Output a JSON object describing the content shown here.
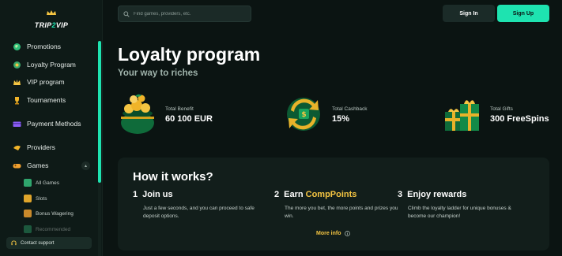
{
  "brand": {
    "logo_text_a": "TRIP",
    "logo_text_b": "2",
    "logo_text_c": "VIP"
  },
  "header": {
    "search_placeholder": "Find games, providers, etc.",
    "signin_label": "Sign In",
    "signup_label": "Sign Up"
  },
  "sidebar": {
    "items": [
      {
        "label": "Promotions",
        "icon": "globe-icon"
      },
      {
        "label": "Loyalty Program",
        "icon": "loyalty-icon"
      },
      {
        "label": "VIP program",
        "icon": "crown-icon"
      },
      {
        "label": "Tournaments",
        "icon": "trophy-icon"
      },
      {
        "label": "Payment Methods",
        "icon": "card-icon"
      },
      {
        "label": "Providers",
        "icon": "providers-icon"
      },
      {
        "label": "Games",
        "icon": "gamepad-icon"
      }
    ],
    "sub_items": [
      {
        "label": "All Games",
        "icon": "grid-icon"
      },
      {
        "label": "Slots",
        "icon": "slots-icon"
      },
      {
        "label": "Bonus Wagering",
        "icon": "bonus-icon"
      },
      {
        "label": "Recommended",
        "icon": "recommended-icon"
      }
    ],
    "support_label": "Contact support"
  },
  "main": {
    "title": "Loyalty program",
    "subtitle": "Your way to riches",
    "stats": [
      {
        "label": "Total Benefit",
        "value": "60 100 EUR",
        "icon": "coin-pot-icon"
      },
      {
        "label": "Total Cashback",
        "value": "15%",
        "icon": "cashback-icon"
      },
      {
        "label": "Total Gifts",
        "value": "300 FreeSpins",
        "icon": "gifts-icon"
      }
    ],
    "how": {
      "title": "How it works?",
      "steps": [
        {
          "num": "1",
          "title": "Join us",
          "accent": "",
          "desc": "Just a few seconds, and you can proceed to safe deposit options."
        },
        {
          "num": "2",
          "title": "Earn ",
          "accent": "CompPoints",
          "desc": "The more you bet, the more points and prizes you win."
        },
        {
          "num": "3",
          "title": "Enjoy rewards",
          "accent": "",
          "desc": "Climb the loyalty ladder for unique bonuses & become our champion!"
        }
      ],
      "more_info": "More info"
    }
  },
  "colors": {
    "accent": "#1ee3b0",
    "gold": "#f5c542",
    "bg": "#0b1412"
  }
}
